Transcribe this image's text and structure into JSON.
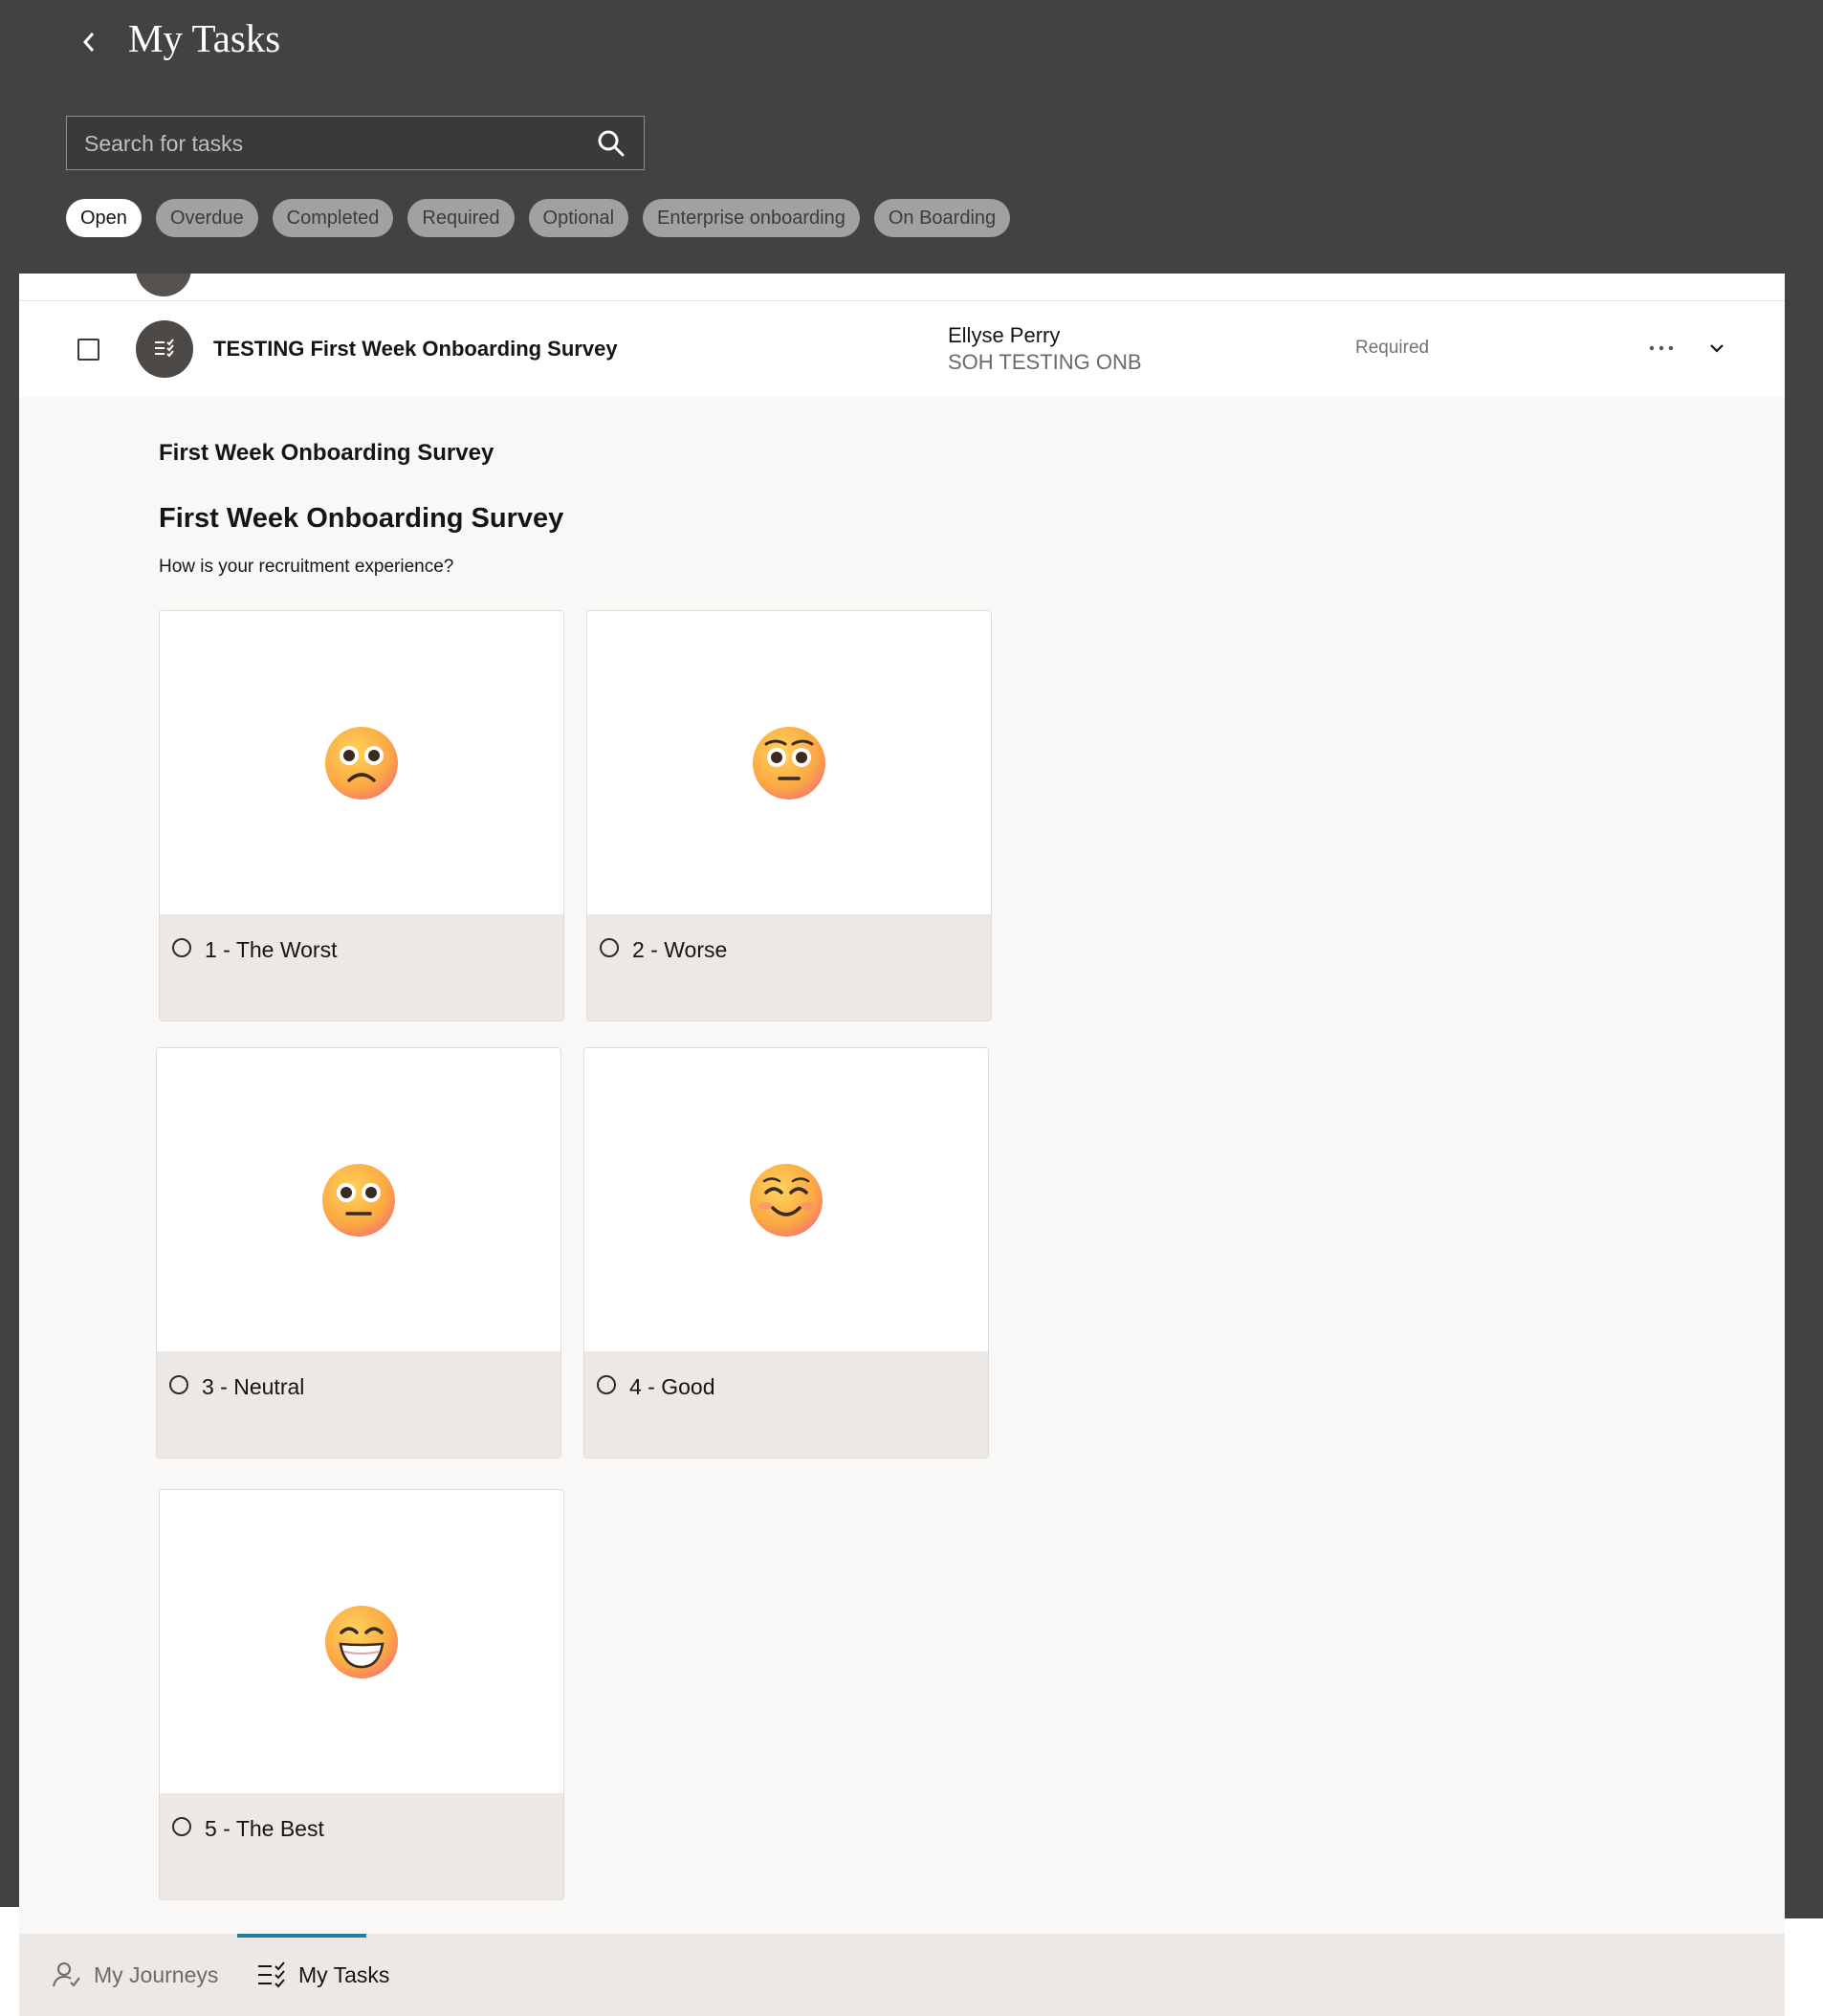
{
  "header": {
    "title": "My Tasks",
    "back_icon": "chevron-left-icon",
    "search": {
      "placeholder": "Search for tasks",
      "value": ""
    },
    "filters": [
      {
        "label": "Open",
        "active": true
      },
      {
        "label": "Overdue",
        "active": false
      },
      {
        "label": "Completed",
        "active": false
      },
      {
        "label": "Required",
        "active": false
      },
      {
        "label": "Optional",
        "active": false
      },
      {
        "label": "Enterprise onboarding",
        "active": false
      },
      {
        "label": "On Boarding",
        "active": false
      }
    ]
  },
  "task": {
    "title": "TESTING First Week Onboarding Survey",
    "assignee_name": "Ellyse Perry",
    "assignee_org": "SOH TESTING ONB",
    "status": "Required",
    "icon": "survey-checklist-icon"
  },
  "survey": {
    "section_title": "First Week Onboarding Survey",
    "title": "First Week Onboarding Survey",
    "question": "How is your recruitment experience?",
    "options": [
      {
        "label": "1 - The Worst",
        "emoji": "sad-face"
      },
      {
        "label": "2 - Worse",
        "emoji": "unamused-face"
      },
      {
        "label": "3 - Neutral",
        "emoji": "neutral-face"
      },
      {
        "label": "4 - Good",
        "emoji": "smiling-face"
      },
      {
        "label": "5 - The Best",
        "emoji": "grinning-face"
      }
    ]
  },
  "bottom_nav": {
    "items": [
      {
        "label": "My Journeys",
        "icon": "user-check-icon",
        "active": false
      },
      {
        "label": "My Tasks",
        "icon": "task-list-icon",
        "active": true
      }
    ]
  },
  "colors": {
    "header_bg": "#424242",
    "panel_bg": "#f9f8f6",
    "option_bg": "#ebe8e6",
    "accent": "#227e9e"
  }
}
